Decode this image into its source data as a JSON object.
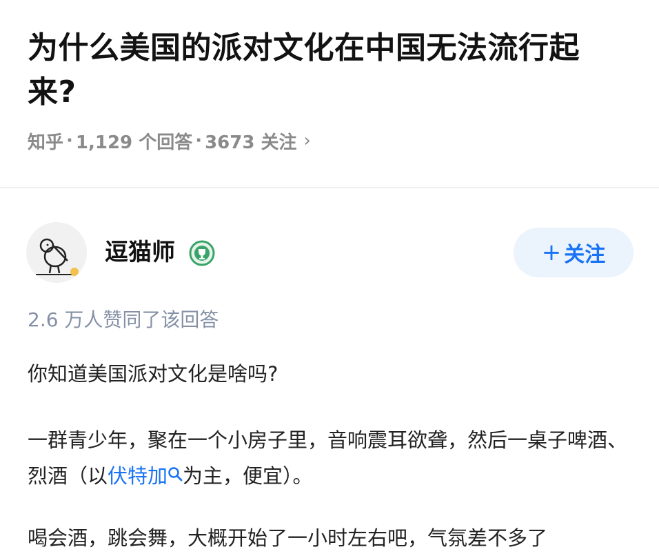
{
  "question": {
    "title": "为什么美国的派对文化在中国无法流行起来?",
    "meta": {
      "source": "知乎",
      "answers": "1,129 个回答",
      "followers": "3673 关注",
      "chevron": "›"
    }
  },
  "author": {
    "name": "逗猫师",
    "avatar_icon": "kiwi-bird-icon",
    "badge_icon": "trophy-badge-icon",
    "follow_label": "关注",
    "follow_plus": "+"
  },
  "answer": {
    "likes": "2.6 万人赞同了该回答",
    "p1": "你知道美国派对文化是啥吗?",
    "p2_before": "一群青少年，聚在一个小房子里，音响震耳欲聋，然后一桌子啤酒、烈酒（以",
    "p2_link": "伏特加",
    "p2_after": "为主，便宜）。",
    "p3": "喝会酒，跳会舞，大概开始了一小时左右吧，气氛差不多了"
  },
  "colors": {
    "accent": "#1772f6",
    "follow_bg": "#ebf3fc",
    "meta_gray": "#8a8a8a",
    "likes_gray": "#8590a6",
    "badge_green": "#3aa36a"
  }
}
